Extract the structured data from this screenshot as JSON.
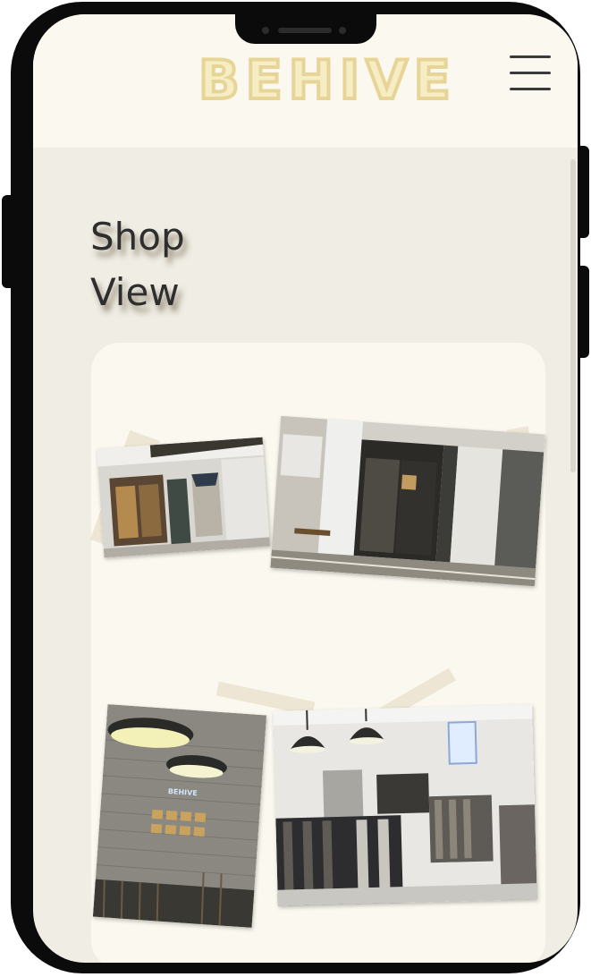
{
  "brand": {
    "logo_text": "BEHIVE"
  },
  "section": {
    "title_line1": "Shop",
    "title_line2": "View"
  },
  "gallery": {
    "photos": [
      {
        "name": "storefront-small",
        "description_icon": "storefront-photo"
      },
      {
        "name": "entrance",
        "description_icon": "entrance-photo"
      },
      {
        "name": "interior-wall",
        "description_icon": "interior-photo",
        "sign": "BEHIVE"
      },
      {
        "name": "clothing-racks",
        "description_icon": "racks-photo"
      }
    ]
  },
  "colors": {
    "accent": "#e7d597",
    "background": "#efede4",
    "header": "#fbf9ef",
    "text": "#2e2e2e"
  }
}
